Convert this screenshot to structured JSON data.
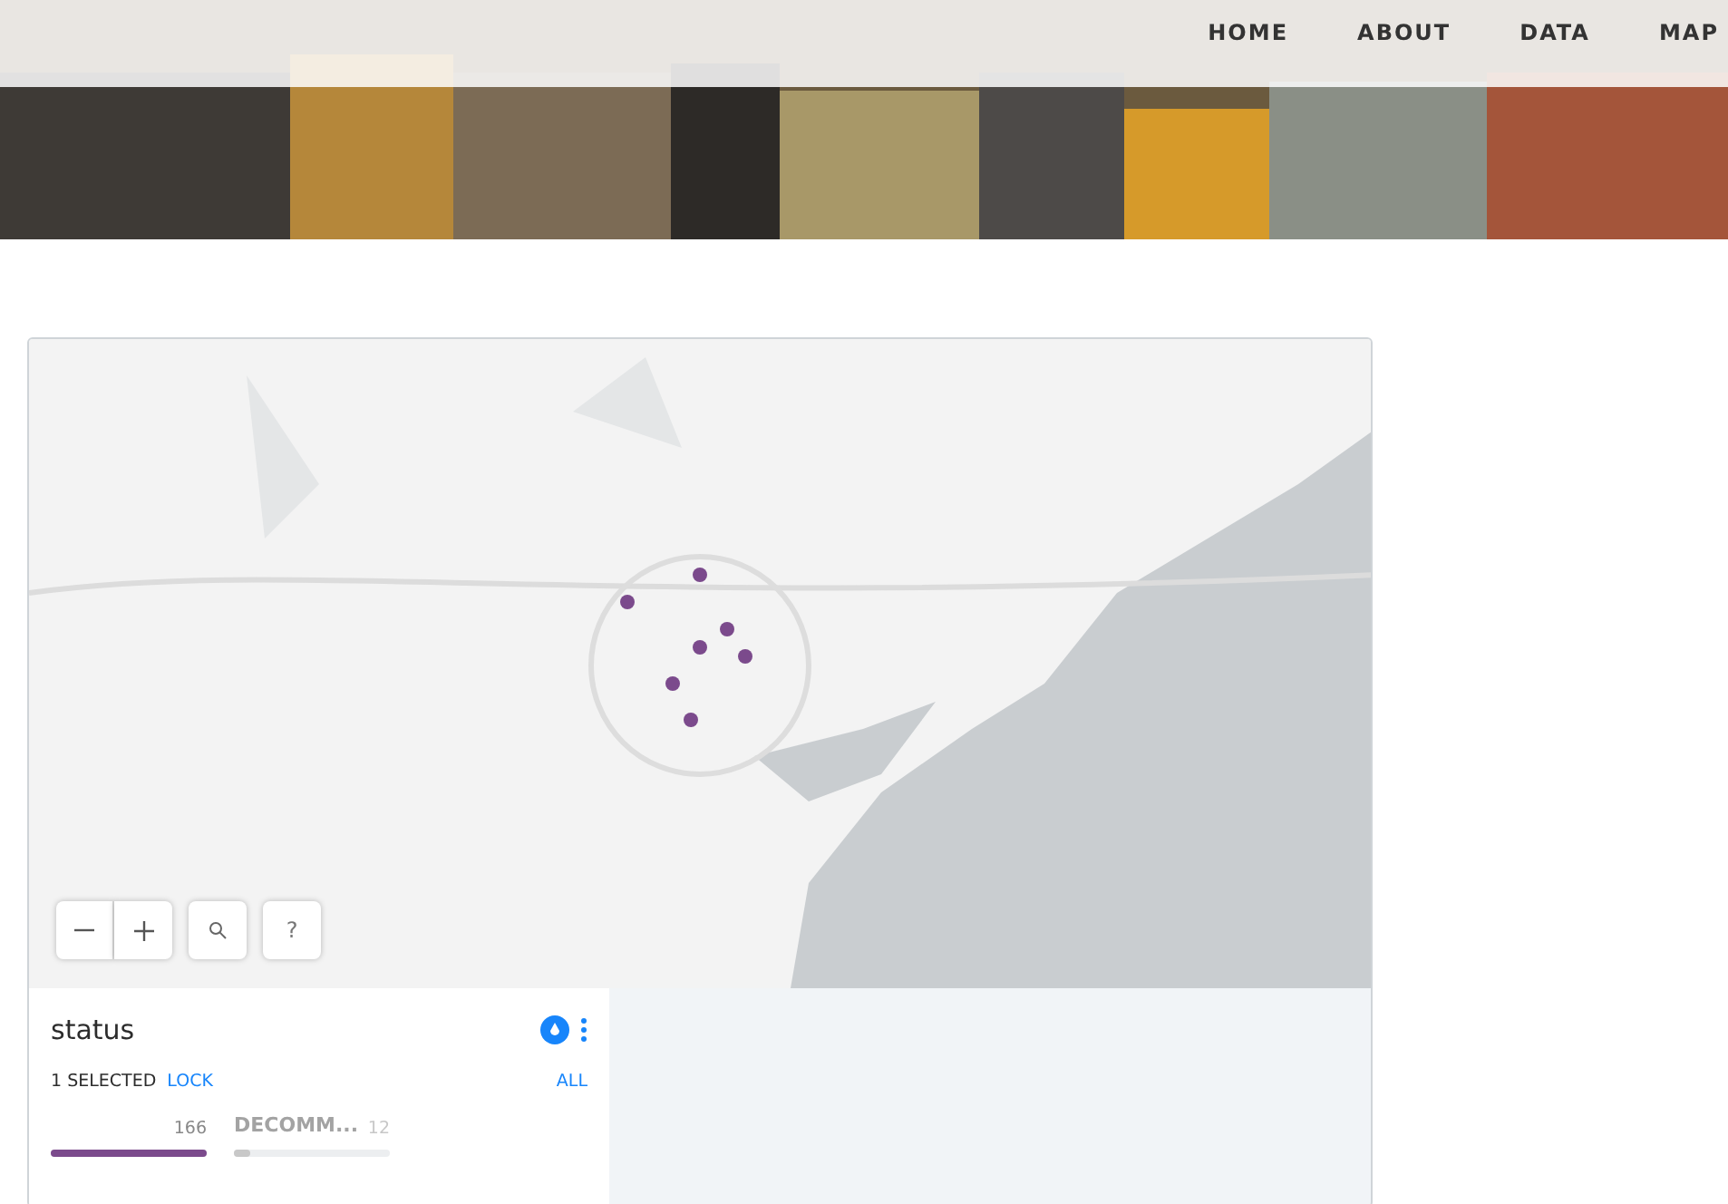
{
  "nav": [
    {
      "label": "HOME"
    },
    {
      "label": "ABOUT"
    },
    {
      "label": "DATA"
    },
    {
      "label": "MAP"
    }
  ],
  "map": {
    "controls": [
      {
        "kind": "zoom-out"
      },
      {
        "kind": "zoom-in"
      },
      {
        "kind": "search"
      },
      {
        "kind": "help",
        "label": "?"
      }
    ]
  },
  "widget": {
    "title": "status",
    "selected_count": "1 SELECTED",
    "lock": "LOCK",
    "all": "ALL",
    "categories": [
      {
        "count": "166",
        "level": 1,
        "selected": true
      },
      {
        "label": "DECOMM...",
        "count": "12",
        "level": 0.1,
        "selected": false
      }
    ]
  }
}
